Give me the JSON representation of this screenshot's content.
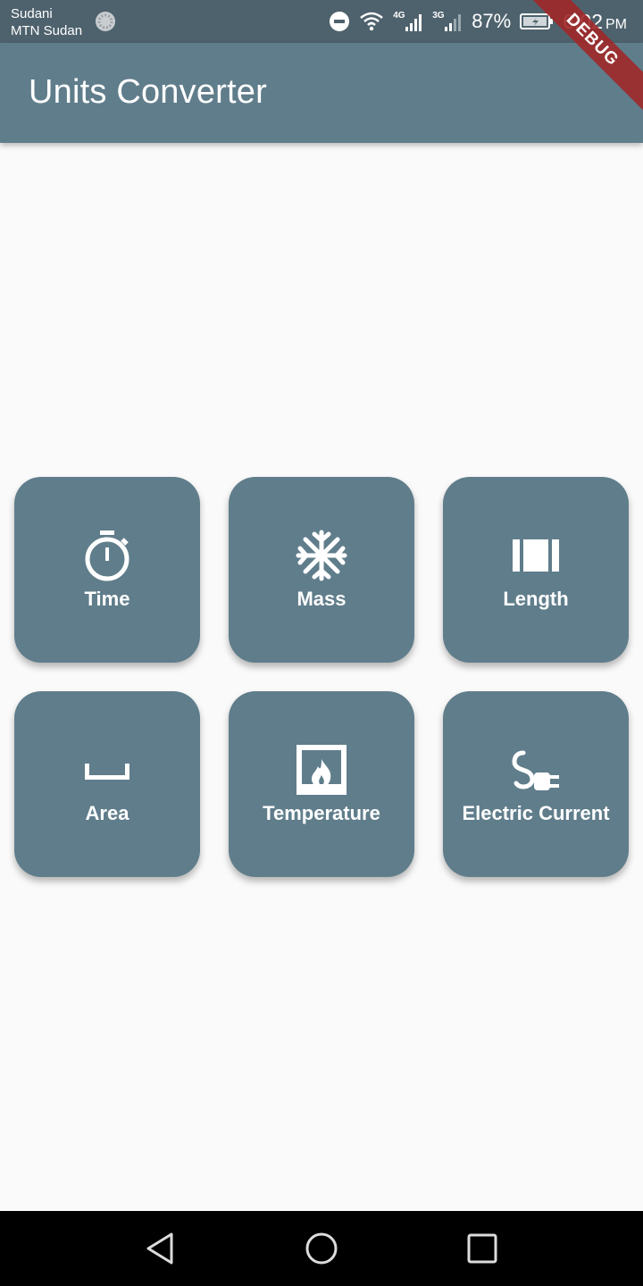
{
  "status_bar": {
    "carrier_line1": "Sudani",
    "carrier_line2": "MTN Sudan",
    "network_a": "4G",
    "network_b": "3G",
    "battery": "87%",
    "time": "6:02",
    "ampm": "PM"
  },
  "app_bar": {
    "title": "Units Converter",
    "debug_label": "DEBUG"
  },
  "categories": [
    {
      "label": "Time",
      "icon": "timer-icon"
    },
    {
      "label": "Mass",
      "icon": "snowflake-icon"
    },
    {
      "label": "Length",
      "icon": "ruler-bars-icon"
    },
    {
      "label": "Area",
      "icon": "space-bar-icon"
    },
    {
      "label": "Temperature",
      "icon": "fireplace-icon"
    },
    {
      "label": "Electric Current",
      "icon": "power-plug-icon"
    }
  ],
  "colors": {
    "primary": "#607d8b",
    "status_bar": "#4e626d",
    "background": "#fafafa",
    "nav_bar": "#000000"
  }
}
